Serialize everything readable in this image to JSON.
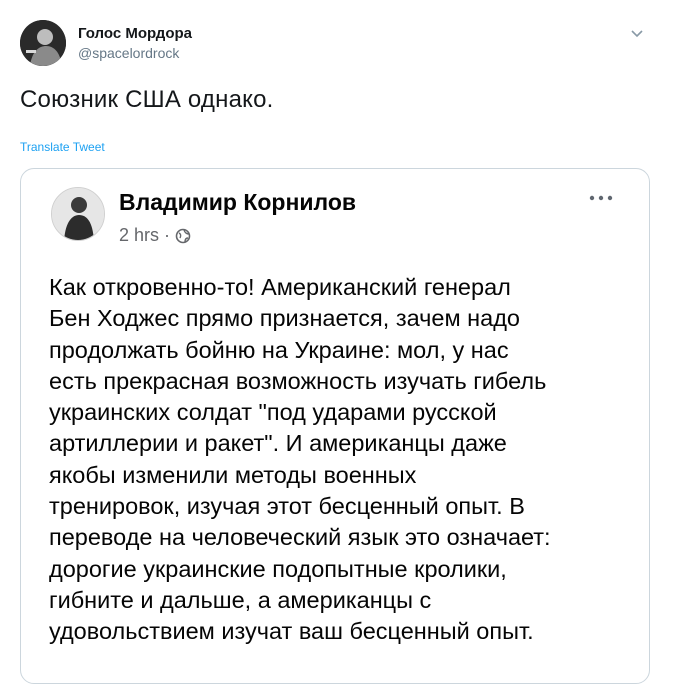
{
  "tweet": {
    "author_name": "Голос Мордора",
    "author_handle": "@spacelordrock",
    "text": "Союзник США однако.",
    "translate_label": "Translate Tweet",
    "avatar_icon": "person-silhouette-icon",
    "menu_icon": "chevron-down-icon"
  },
  "embedded_post": {
    "author_name": "Владимир Корнилов",
    "time": "2 hrs",
    "separator": "·",
    "privacy_icon": "globe-icon",
    "more_icon": "ellipsis-icon",
    "lines": [
      "Как откровенно-то! Американский генерал",
      "Бен Ходжес прямо признается, зачем надо",
      "продолжать бойню на Украине: мол, у нас",
      "есть прекрасная возможность изучать гибель",
      "украинских солдат \"под ударами русской",
      "артиллерии и ракет\". И американцы даже",
      "якобы изменили методы военных",
      "тренировок, изучая этот бесценный опыт. В",
      "переводе на человеческий язык это означает:",
      "дорогие украинские подопытные кролики,",
      "гибните и дальше, а американцы с",
      "удовольствием изучат ваш бесценный опыт."
    ]
  },
  "colors": {
    "link_blue": "#1da1f2",
    "secondary_gray": "#657786",
    "card_border": "#ccd6dd"
  }
}
